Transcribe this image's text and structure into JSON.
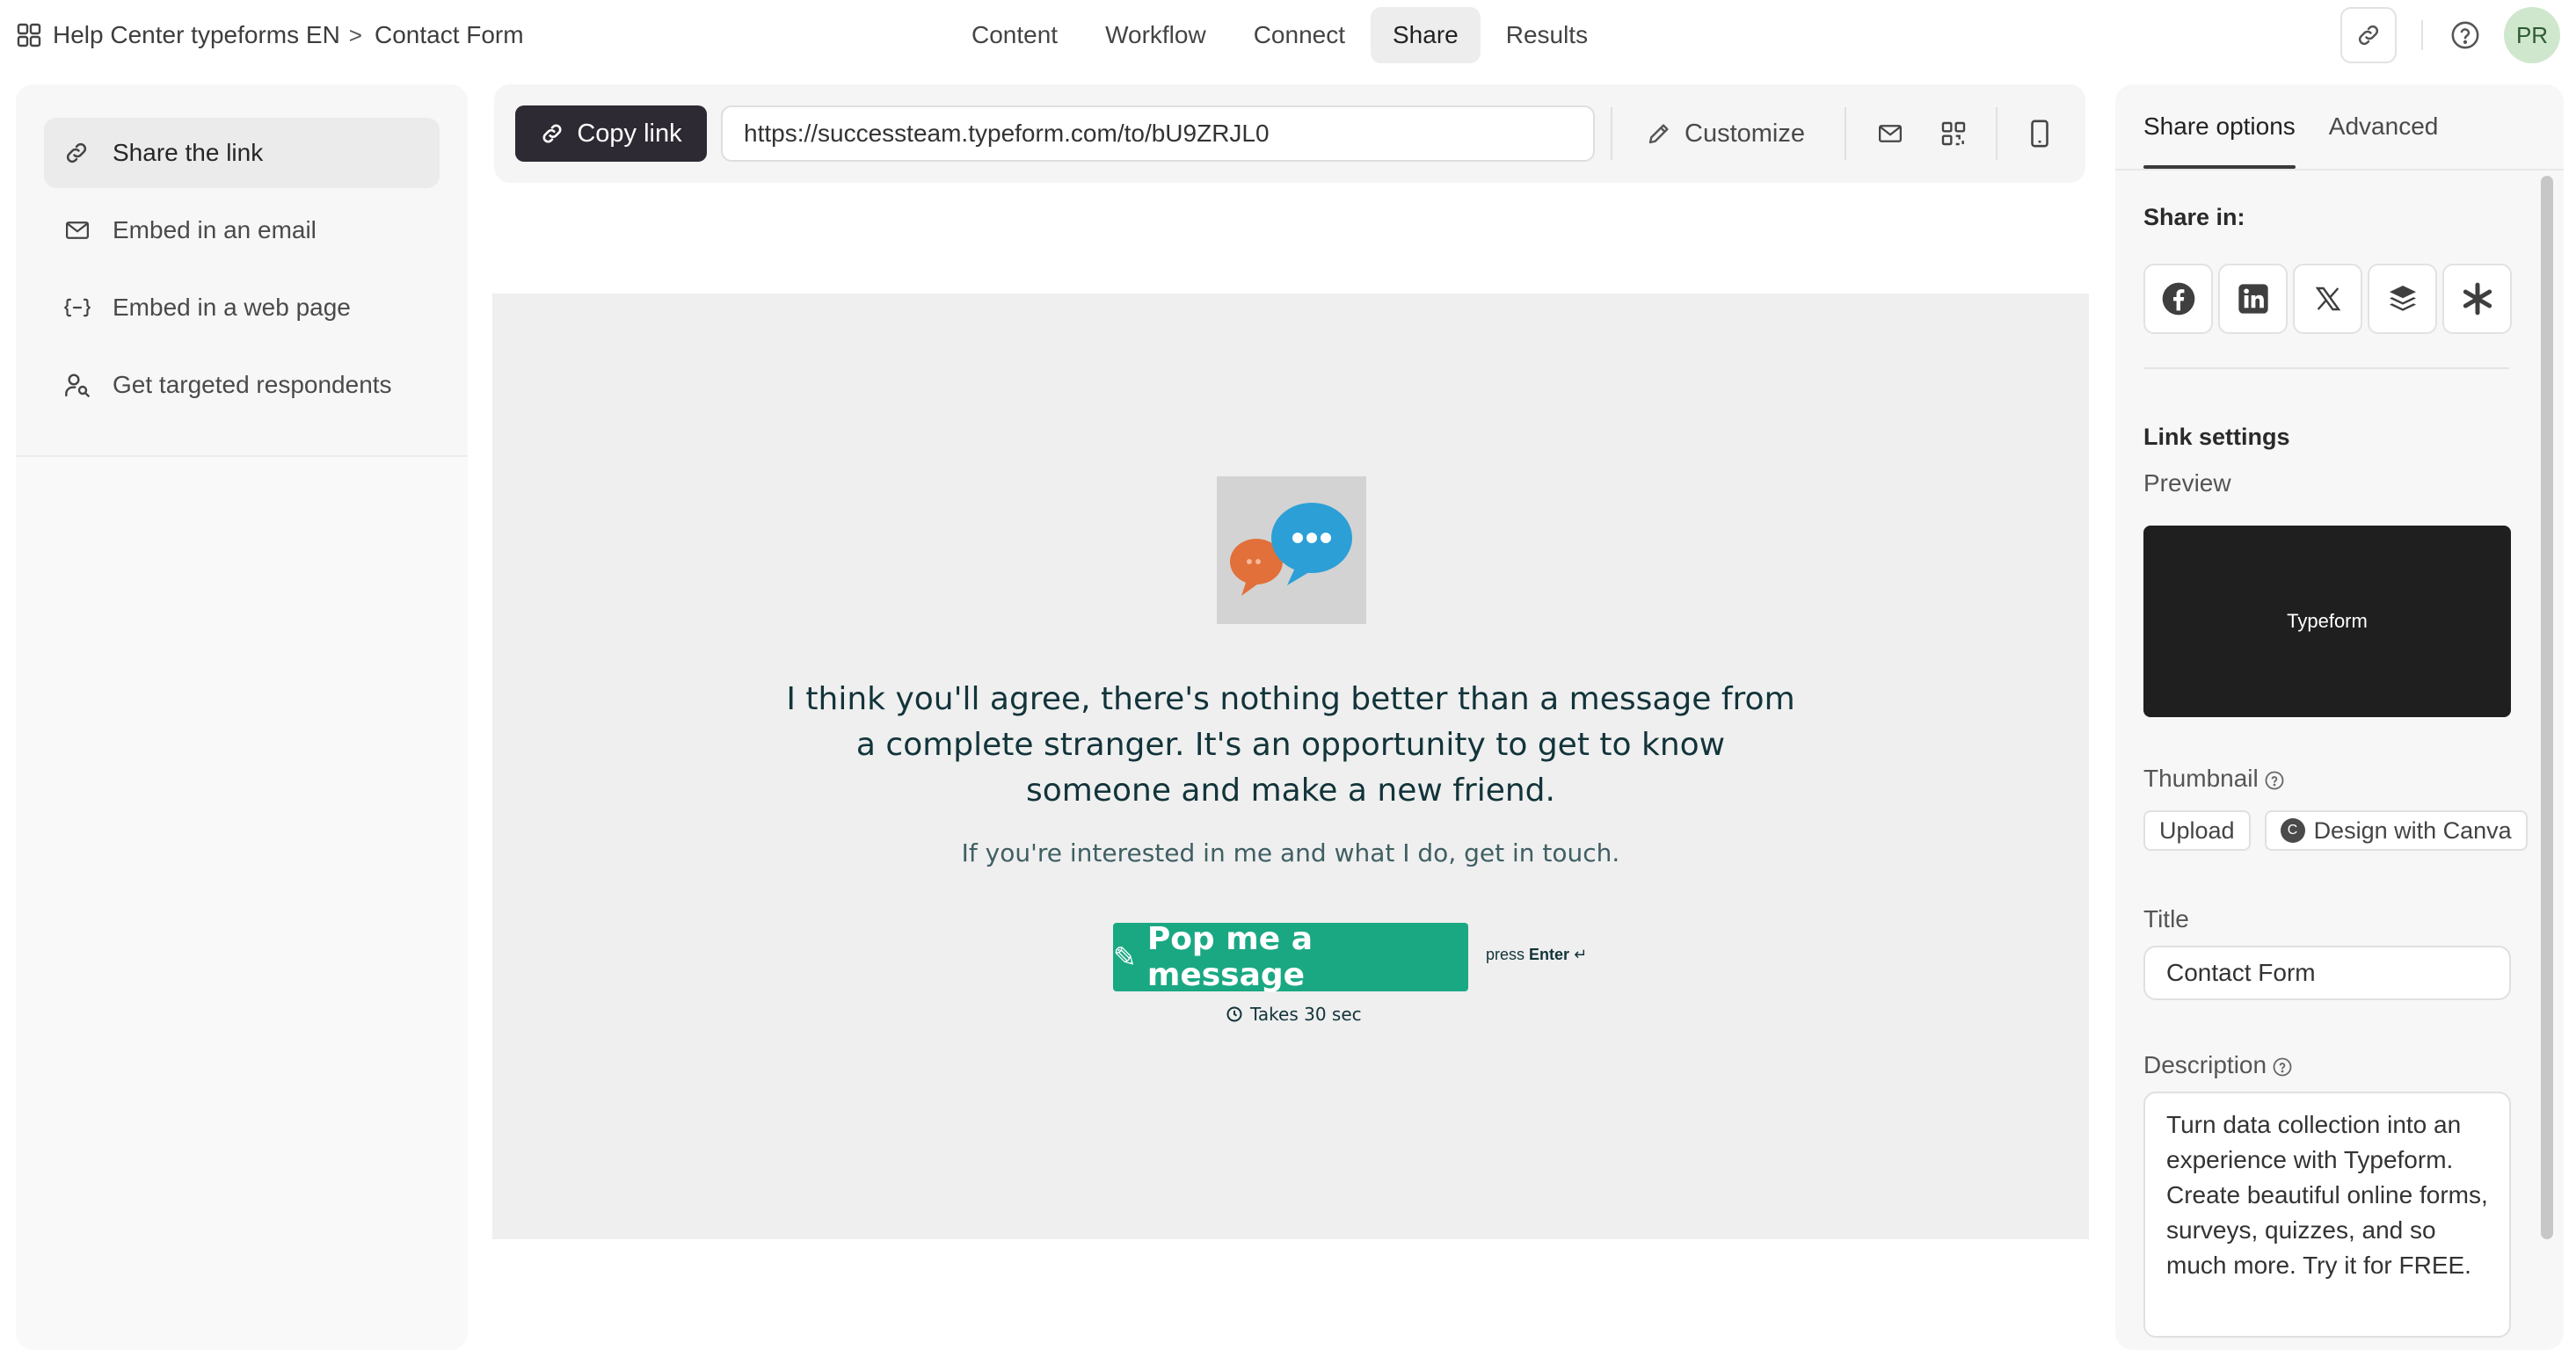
{
  "header": {
    "workspace": "Help Center typeforms EN",
    "separator": ">",
    "form_name": "Contact Form",
    "tabs": [
      {
        "label": "Content"
      },
      {
        "label": "Workflow"
      },
      {
        "label": "Connect"
      },
      {
        "label": "Share"
      },
      {
        "label": "Results"
      }
    ],
    "active_tab": "Share",
    "avatar_initials": "PR"
  },
  "sidebar": {
    "items": [
      {
        "label": "Share the link",
        "icon": "link-icon"
      },
      {
        "label": "Embed in an email",
        "icon": "mail-icon"
      },
      {
        "label": "Embed in a web page",
        "icon": "code-braces-icon"
      },
      {
        "label": "Get targeted respondents",
        "icon": "user-search-icon"
      }
    ],
    "active_item": "Share the link"
  },
  "linkbar": {
    "copy_label": "Copy link",
    "url": "https://successteam.typeform.com/to/bU9ZRJL0",
    "customize_label": "Customize"
  },
  "preview": {
    "headline": "I think you'll agree, there's nothing better than a message from a complete stranger. It's an opportunity to get to know someone and make a new friend.",
    "subtext": "If you're interested in me and what I do, get in touch.",
    "cta_label": "Pop me a message",
    "cta_icon": "pencil-glyph",
    "hint_prefix": "press",
    "hint_key": "Enter",
    "hint_symbol": "↵",
    "time_label": "Takes 30 sec",
    "accent_color": "#1aa883"
  },
  "right_panel": {
    "tabs": [
      {
        "label": "Share options"
      },
      {
        "label": "Advanced"
      }
    ],
    "active_tab": "Share options",
    "share_in_label": "Share in:",
    "social": [
      "facebook-icon",
      "linkedin-icon",
      "x-icon",
      "buffer-icon",
      "asterisk-icon"
    ],
    "link_settings_label": "Link settings",
    "preview_label": "Preview",
    "preview_card_text": "Typeform",
    "thumbnail_label": "Thumbnail",
    "upload_label": "Upload",
    "canva_badge": "C",
    "canva_label": "Design with Canva",
    "title_label": "Title",
    "title_value": "Contact Form",
    "description_label": "Description",
    "description_value": "Turn data collection into an experience with Typeform. Create beautiful online forms, surveys, quizzes, and so much more. Try it for FREE."
  }
}
